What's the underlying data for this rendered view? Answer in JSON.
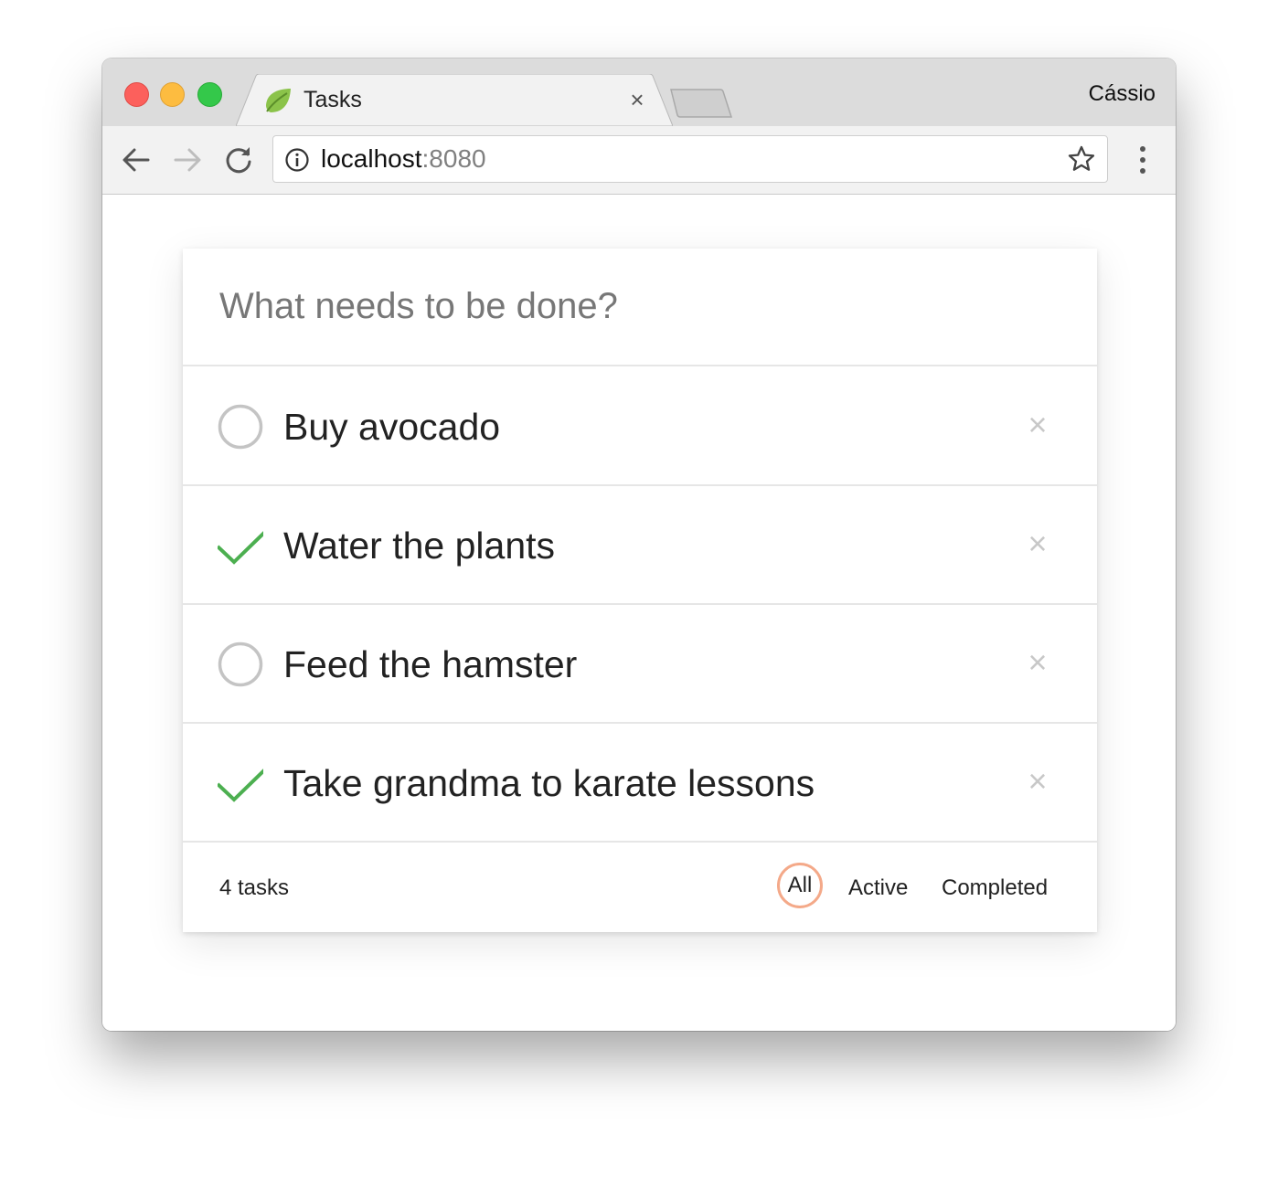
{
  "browser": {
    "tab_title": "Tasks",
    "tab_close_glyph": "×",
    "profile_name": "Cássio",
    "url_host": "localhost",
    "url_port": ":8080",
    "icons": {
      "favicon": "leaf-icon",
      "back": "arrow-left-icon",
      "forward": "arrow-right-icon",
      "reload": "reload-icon",
      "info": "info-icon",
      "bookmark": "star-icon",
      "menu": "kebab-menu-icon"
    }
  },
  "app": {
    "new_todo_placeholder": "What needs to be done?",
    "todos": [
      {
        "text": "Buy avocado",
        "completed": false
      },
      {
        "text": "Water the plants",
        "completed": true
      },
      {
        "text": "Feed the hamster",
        "completed": false
      },
      {
        "text": "Take grandma to karate lessons",
        "completed": true
      }
    ],
    "destroy_glyph": "×",
    "footer": {
      "count_label": "4 tasks",
      "filters": [
        "All",
        "Active",
        "Completed"
      ],
      "selected_filter": "All"
    }
  },
  "colors": {
    "check_green": "#4caf50",
    "filter_selected_ring": "#f4a989",
    "circle_gray": "#c4c4c4"
  }
}
